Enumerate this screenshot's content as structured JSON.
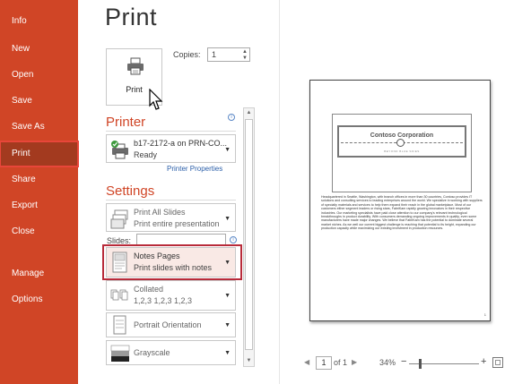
{
  "nav": {
    "items": [
      {
        "label": "Info"
      },
      {
        "label": "New"
      },
      {
        "label": "Open"
      },
      {
        "label": "Save"
      },
      {
        "label": "Save As"
      },
      {
        "label": "Print"
      },
      {
        "label": "Share"
      },
      {
        "label": "Export"
      },
      {
        "label": "Close"
      },
      {
        "label": "Manage"
      },
      {
        "label": "Options"
      }
    ],
    "selected": "Print",
    "accent_color": "#d04526"
  },
  "page_title": "Print",
  "print_button": {
    "label": "Print",
    "icon": "printer-icon"
  },
  "copies": {
    "label": "Copies:",
    "value": "1"
  },
  "printer_section": {
    "heading": "Printer",
    "name": "b17-2172-a on PRN-CO...",
    "status": "Ready",
    "properties_link": "Printer Properties"
  },
  "settings_section": {
    "heading": "Settings",
    "slides_range": {
      "title": "Print All Slides",
      "subtitle": "Print entire presentation"
    },
    "slides_label": "Slides:",
    "slides_value": "",
    "layout": {
      "title": "Notes Pages",
      "subtitle": "Print slides with notes"
    },
    "collation": {
      "title": "Collated",
      "subtitle": "1,2,3    1,2,3    1,2,3"
    },
    "orientation": {
      "title": "Portrait Orientation"
    },
    "color": {
      "title": "Grayscale"
    }
  },
  "preview": {
    "slide_title": "Contoso Corporation",
    "slide_subtitle": "BEYOND BLUE SKIES",
    "notes_text": "Headquartered in Seattle, Washington, with branch offices in more than 30 countries, Contoso provides IT solutions and consulting services to leading enterprises around the world. We specialize in working with suppliers of specialty materials and services to help them expand their reach in the global marketplace. Most of our customers either segment leaders or rising stars, FabriKam rapidly growing innovators in their respective industries. Our marketing specialists have paid close attention to our company's relevant technological breakthroughs in product durability. With consumers demanding ongoing improvements in quality, even some manufacturers have made major changes. We believe that FabriKam has the potential to dominate several market niches. As we well our current biggest challenge is reaching that potential to its height, expanding our production capacity while maximizing our existing investment in production resources.",
    "page_number": "1"
  },
  "footer": {
    "current_page": "1",
    "of_label": "of 1",
    "zoom": "34%"
  }
}
